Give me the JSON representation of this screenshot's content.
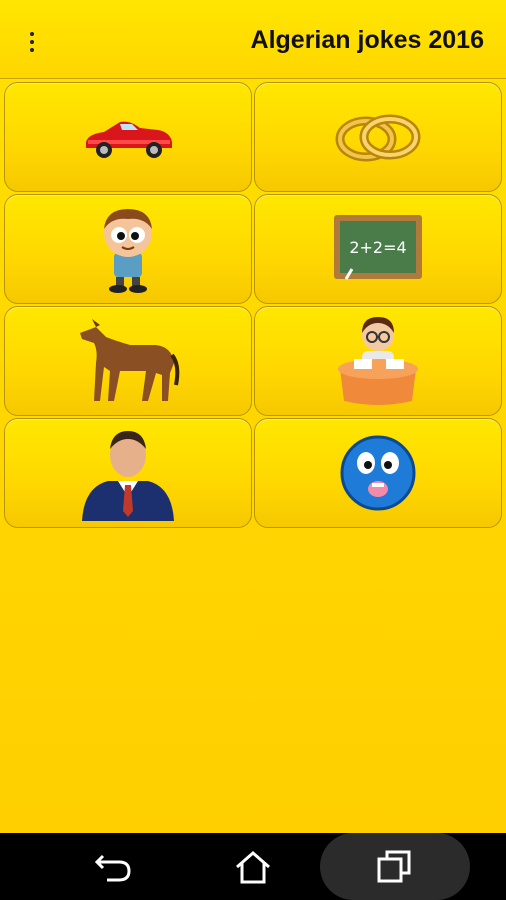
{
  "app": {
    "title": "Algerian jokes 2016",
    "colors": {
      "background": "#ffd800",
      "text": "#111111"
    }
  },
  "grid": {
    "tiles": [
      {
        "name": "tile-car",
        "icon": "red-car-icon"
      },
      {
        "name": "tile-rings",
        "icon": "wedding-rings-icon"
      },
      {
        "name": "tile-boy",
        "icon": "boy-icon"
      },
      {
        "name": "tile-chalkboard",
        "icon": "chalkboard-math-icon"
      },
      {
        "name": "tile-horse",
        "icon": "horse-icon"
      },
      {
        "name": "tile-teacher",
        "icon": "teacher-at-desk-icon"
      },
      {
        "name": "tile-businessman",
        "icon": "businessman-icon"
      },
      {
        "name": "tile-smiley",
        "icon": "blue-smiley-icon"
      }
    ]
  },
  "chalkboard": {
    "equation": "2+2=4"
  },
  "navbar": {
    "back_icon": "back-icon",
    "home_icon": "home-icon",
    "recents_icon": "recents-icon"
  }
}
